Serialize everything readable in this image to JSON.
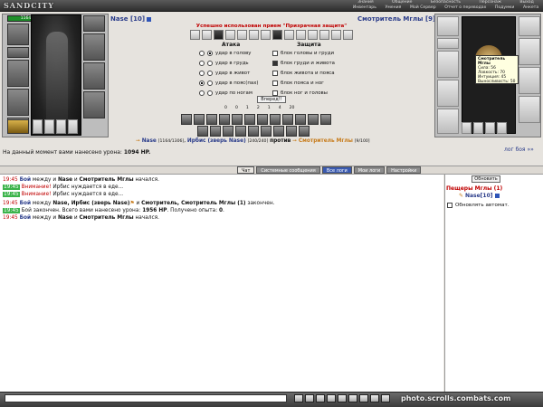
{
  "app": {
    "logo": "SANDCITY"
  },
  "top_menu": {
    "row1": [
      "Знания",
      "Общение",
      "Безопасность",
      "Персонаж",
      "Выход"
    ],
    "row2": [
      "Инвентарь",
      "Умения",
      "Мой Сервер",
      "Отчет о переводах",
      "Подумки",
      "Анкета"
    ]
  },
  "player": {
    "name": "Nase",
    "level": "[10]",
    "hp": "1164/1306"
  },
  "enemy": {
    "name": "Смотритель Мглы",
    "level": "[9]"
  },
  "battle": {
    "notice": "Успешно использован прием \"Призрачная защита\"",
    "attack_title": "Атака",
    "defense_title": "Защита",
    "attack_options": [
      "удар в голову",
      "удар в грудь",
      "удар в живот",
      "удар в пояс(пах)",
      "удар по ногам"
    ],
    "defense_options": [
      "блок головы и груди",
      "блок груди и живота",
      "блок живота и пояса",
      "блок пояса и ног",
      "блок ног и головы"
    ],
    "forward_button": "Вперед!!",
    "stats": [
      "0",
      "0",
      "1",
      "2",
      "1",
      "4",
      "20"
    ],
    "vs": {
      "left1": "Nase",
      "left1_hp": "[1164/1306]",
      "left2": "Ирбис (зверь Nase)",
      "left2_hp": "[240/240]",
      "vs_word": "против",
      "right": "Смотритель Мглы",
      "right_hp": "[9/100]"
    },
    "damage_label": "На данный момент вами нанесено урона:",
    "damage_value": "1094 HP.",
    "log_link": "лог боя »»"
  },
  "tooltip": {
    "title": "Смотритель Мглы",
    "lines": [
      "Сила: 56",
      "Ловкость: 70",
      "Интуиция: 45",
      "Выносливость: 50"
    ]
  },
  "tabs": [
    "Чат",
    "Системные сообщения",
    "Все логи",
    "Мои логи",
    "Настройки"
  ],
  "chat_lines": [
    {
      "time": "19:45",
      "parts": [
        "Бой",
        " между и ",
        "Nase",
        " и ",
        "Смотритель Мглы",
        " начался."
      ]
    },
    {
      "time": "19:45",
      "warn": "Внимание!",
      "text": " Ирбис нуждается в еде..."
    },
    {
      "time": "19:45",
      "warn": "Внимание!",
      "text": " Ирбис нуждается в еде..."
    },
    {
      "time": "19:45",
      "parts": [
        "Бой",
        " между ",
        "Nase, Ирбис (зверь Nase)",
        " и ",
        "Смотритель, Смотритель Мглы (1)",
        " закончен."
      ]
    },
    {
      "time": "19:45",
      "text": "Бой закончен. Всего вами нанесено урона: ",
      "bold": "1956 HP",
      "text2": ". Получено опыта: ",
      "bold2": "0",
      "text3": "."
    },
    {
      "time": "19:45",
      "parts": [
        "Бой",
        " между и ",
        "Nase",
        " и ",
        "Смотритель Мглы",
        " начался."
      ]
    }
  ],
  "sidebar": {
    "refresh": "Обновить",
    "location": "Пещеры Мглы (1)",
    "user": "Nase[10]",
    "auto_label": "Обновлять автомат."
  },
  "watermark": "photo.scrolls.combats.com"
}
